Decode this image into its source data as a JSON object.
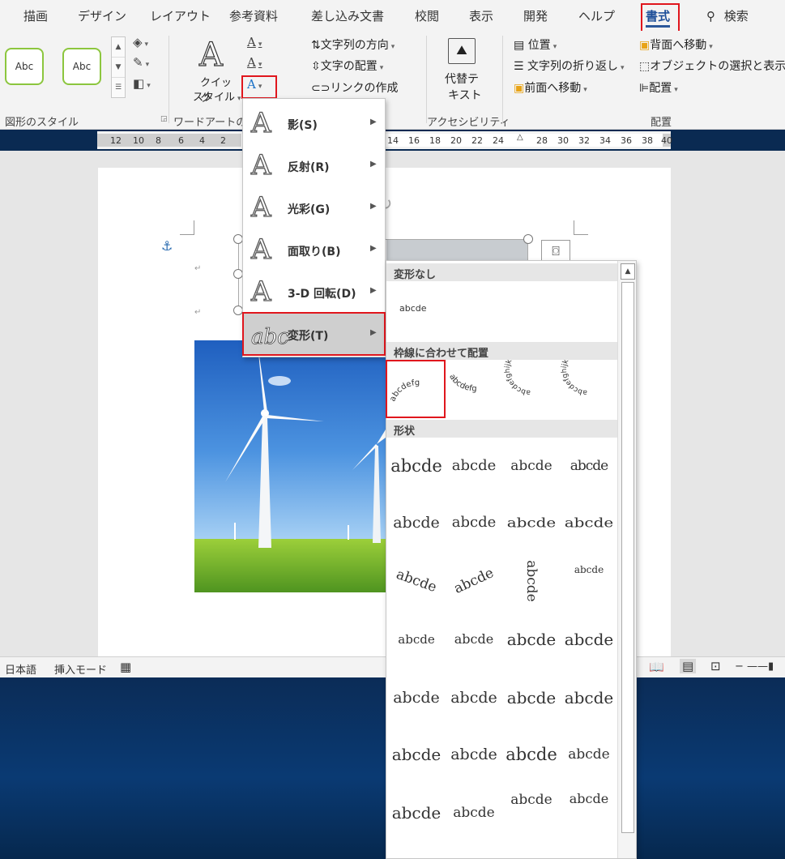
{
  "ribbon_tabs": [
    "描画",
    "デザイン",
    "レイアウト",
    "参考資料",
    "差し込み文書",
    "校閲",
    "表示",
    "開発",
    "ヘルプ",
    "書式"
  ],
  "search_label": "検索",
  "shape_styles": {
    "sample_label": "Abc",
    "group_label": "図形のスタイル"
  },
  "wordart": {
    "quick_style_label": [
      "クイック",
      "スタイル"
    ],
    "group_label": "ワードアートの",
    "glyph": "A"
  },
  "text_group": {
    "direction": "文字列の方向",
    "align": "文字の配置",
    "link": "リンクの作成"
  },
  "accessibility": {
    "alt_text": [
      "代替テ",
      "キスト"
    ],
    "group_label": "アクセシビリティ"
  },
  "arrange": {
    "position": "位置",
    "wrap": "文字列の折り返し",
    "bring_forward": "前面へ移動",
    "send_backward": "背面へ移動",
    "selection_pane": "オブジェクトの選択と表示",
    "align": "配置",
    "group_label": "配置"
  },
  "ruler_ticks": [
    "12",
    "10",
    "8",
    "6",
    "4",
    "2",
    "14",
    "16",
    "18",
    "20",
    "22",
    "24",
    "28",
    "30",
    "32",
    "34",
    "36",
    "38",
    "40"
  ],
  "effects_menu": [
    {
      "label": "影(S)",
      "icon": "A",
      "selected": false
    },
    {
      "label": "反射(R)",
      "icon": "A",
      "selected": false
    },
    {
      "label": "光彩(G)",
      "icon": "A",
      "selected": false
    },
    {
      "label": "面取り(B)",
      "icon": "A",
      "selected": false
    },
    {
      "label": "3-D 回転(D)",
      "icon": "A",
      "selected": false
    },
    {
      "label": "変形(T)",
      "icon": "abc",
      "selected": true
    }
  ],
  "gallery": {
    "sections": {
      "no_transform": "変形なし",
      "follow_path": "枠線に合わせて配置",
      "warp": "形状"
    },
    "sample_text": "abcde",
    "path_samples": [
      "abcdefg",
      "abcdefg",
      "abcdefghijklmn",
      "abcdefghijklmnop"
    ],
    "warp_rows": [
      [
        "abcde",
        "abcde",
        "abcde",
        "abcde"
      ],
      [
        "abcde",
        "abcde",
        "abcde",
        "abcde"
      ],
      [
        "abcde",
        "abcde",
        "abcde",
        "abcde"
      ],
      [
        "abcde",
        "abcde",
        "abcde",
        "abcde"
      ],
      [
        "abcde",
        "abcde",
        "abcde",
        "abcde"
      ],
      [
        "abcde",
        "abcde",
        "abcde",
        "abcde"
      ],
      [
        "abcde",
        "abcde",
        "abcde",
        "abcde"
      ]
    ]
  },
  "status": {
    "language": "日本語",
    "mode": "挿入モード"
  }
}
